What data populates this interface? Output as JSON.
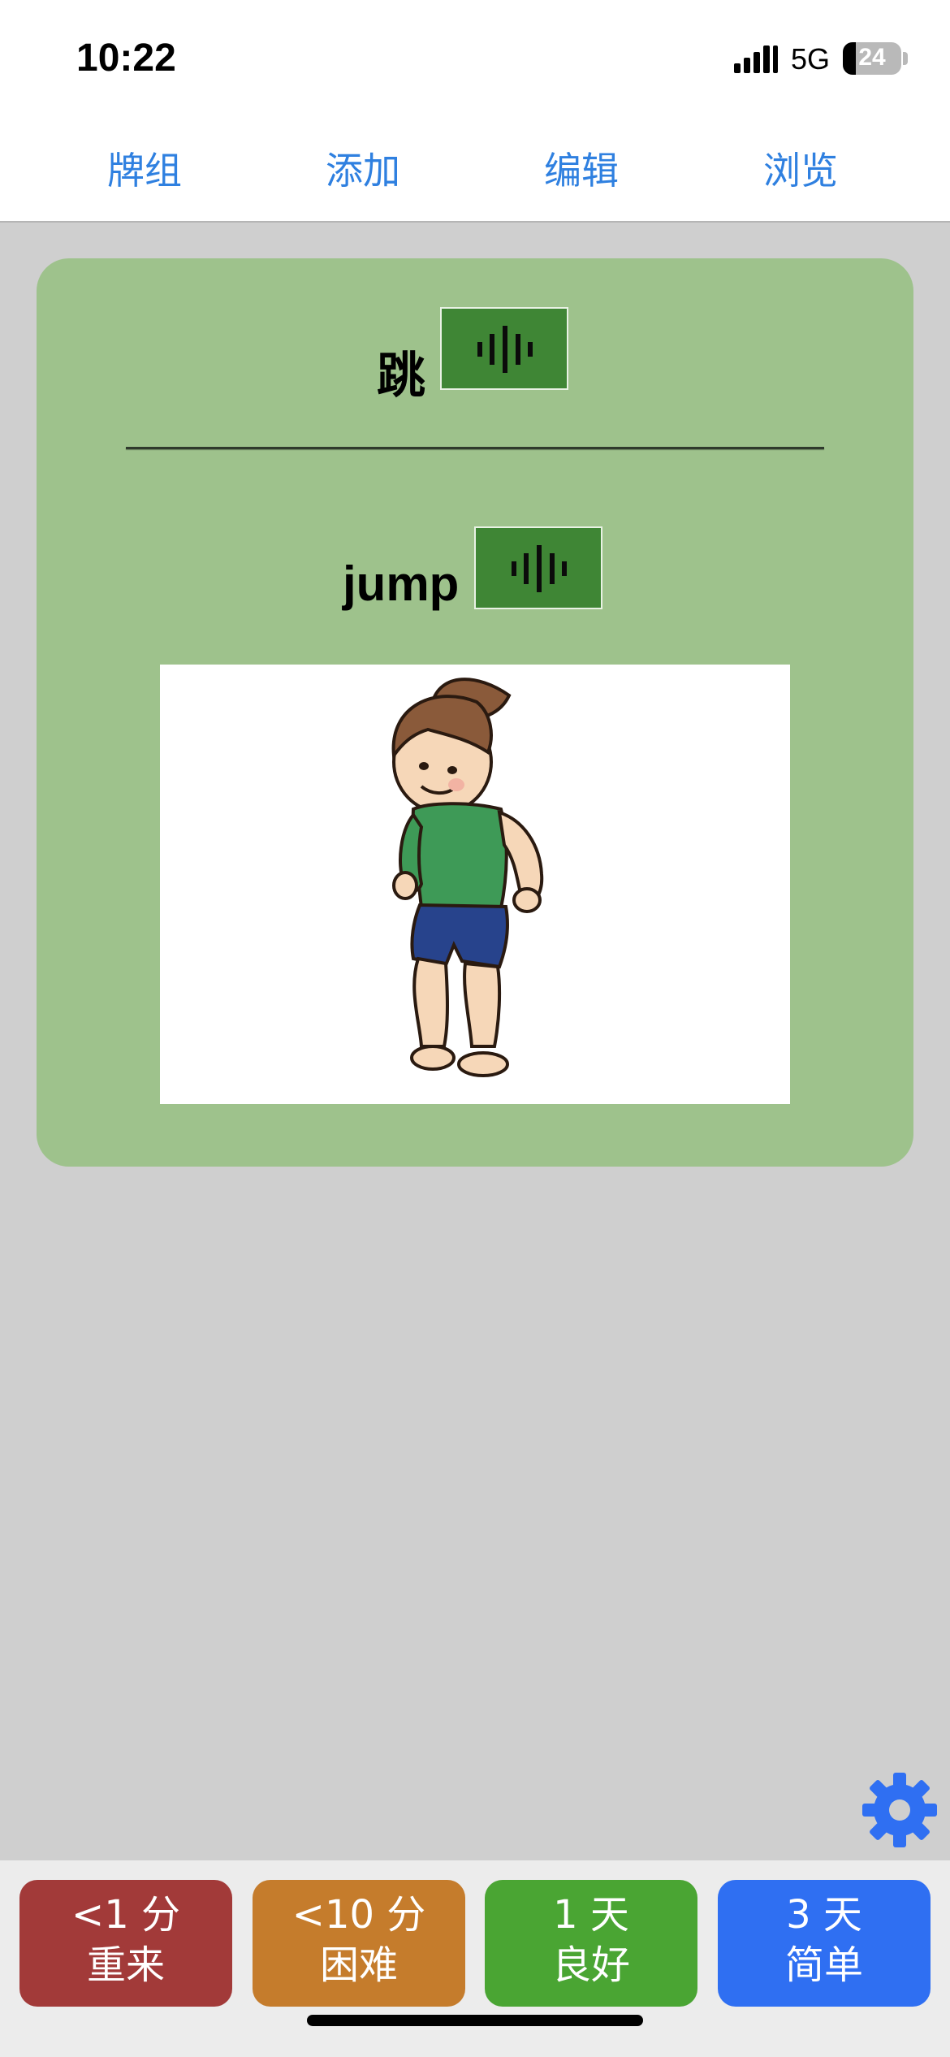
{
  "status_bar": {
    "time": "10:22",
    "network": "5G",
    "battery": "24"
  },
  "nav": {
    "decks": "牌组",
    "add": "添加",
    "edit": "编辑",
    "browse": "浏览"
  },
  "card": {
    "front": "跳",
    "back": "jump",
    "image_desc": "girl-jumping-illustration"
  },
  "answers": {
    "again": {
      "interval": "<1 分",
      "label": "重来",
      "color": "#a23a39"
    },
    "hard": {
      "interval": "<10 分",
      "label": "困难",
      "color": "#c57c2c"
    },
    "good": {
      "interval": "1 天",
      "label": "良好",
      "color": "#4aa533"
    },
    "easy": {
      "interval": "3 天",
      "label": "简单",
      "color": "#2f6ff2"
    }
  },
  "colors": {
    "card_bg": "#9ec28c",
    "audio_button": "#3f8635",
    "nav_link": "#2f80e0",
    "gear": "#2f6ff2"
  },
  "icons": {
    "audio": "waveform-icon",
    "settings": "gear-icon"
  }
}
